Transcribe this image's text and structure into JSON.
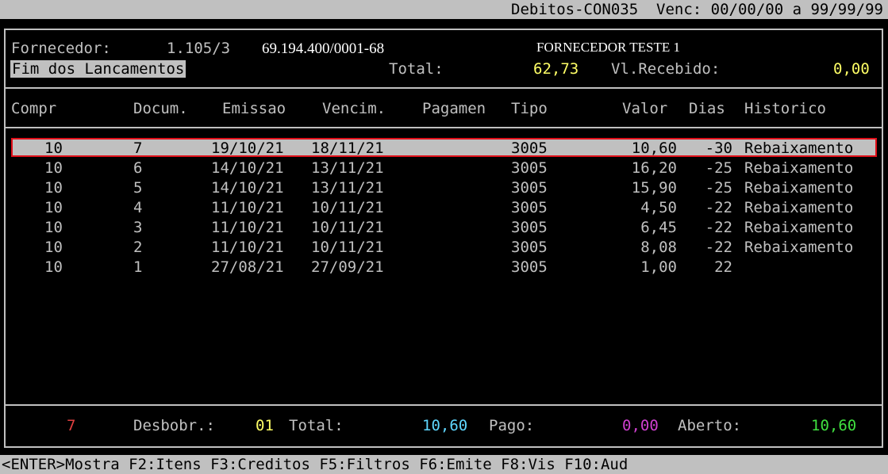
{
  "window": {
    "title": "Debitos-CON035  Venc: 00/00/00 a 99/99/99"
  },
  "header": {
    "fornecedor_label": "Fornecedor:",
    "fornecedor_code": "1.105/3",
    "cnpj": "69.194.400/0001-68",
    "fornecedor_name": "FORNECEDOR TESTE 1",
    "status": "Fim dos Lancamentos",
    "total_label": "Total:",
    "total_value": "62,73",
    "recebido_label": "Vl.Recebido:",
    "recebido_value": "0,00"
  },
  "table": {
    "columns": [
      "Compr",
      "Docum.",
      "Emissao",
      "Vencim.",
      "Pagamen",
      "Tipo",
      "Valor",
      "Dias",
      "Historico"
    ],
    "rows": [
      {
        "compr": "10",
        "docum": "7",
        "emissao": "19/10/21",
        "vencim": "18/11/21",
        "pagamen": "",
        "tipo": "3005",
        "valor": "10,60",
        "dias": "-30",
        "historico": "Rebaixamento"
      },
      {
        "compr": "10",
        "docum": "6",
        "emissao": "14/10/21",
        "vencim": "13/11/21",
        "pagamen": "",
        "tipo": "3005",
        "valor": "16,20",
        "dias": "-25",
        "historico": "Rebaixamento"
      },
      {
        "compr": "10",
        "docum": "5",
        "emissao": "14/10/21",
        "vencim": "13/11/21",
        "pagamen": "",
        "tipo": "3005",
        "valor": "15,90",
        "dias": "-25",
        "historico": "Rebaixamento"
      },
      {
        "compr": "10",
        "docum": "4",
        "emissao": "11/10/21",
        "vencim": "10/11/21",
        "pagamen": "",
        "tipo": "3005",
        "valor": "4,50",
        "dias": "-22",
        "historico": "Rebaixamento"
      },
      {
        "compr": "10",
        "docum": "3",
        "emissao": "11/10/21",
        "vencim": "10/11/21",
        "pagamen": "",
        "tipo": "3005",
        "valor": "6,45",
        "dias": "-22",
        "historico": "Rebaixamento"
      },
      {
        "compr": "10",
        "docum": "2",
        "emissao": "11/10/21",
        "vencim": "10/11/21",
        "pagamen": "",
        "tipo": "3005",
        "valor": "8,08",
        "dias": "-22",
        "historico": "Rebaixamento"
      },
      {
        "compr": "10",
        "docum": "1",
        "emissao": "27/08/21",
        "vencim": "27/09/21",
        "pagamen": "",
        "tipo": "3005",
        "valor": "1,00",
        "dias": "22",
        "historico": ""
      }
    ]
  },
  "footer": {
    "count": "7",
    "desbobr_label": "Desbobr.:",
    "desbobr_value": "01",
    "total_label": "Total:",
    "total_value": "10,60",
    "pago_label": "Pago:",
    "pago_value": "0,00",
    "aberto_label": "Aberto:",
    "aberto_value": "10,60"
  },
  "statusbar": {
    "text": "<ENTER>Mostra F2:Itens F3:Creditos F5:Filtros F6:Emite F8:Vis F10:Aud"
  }
}
